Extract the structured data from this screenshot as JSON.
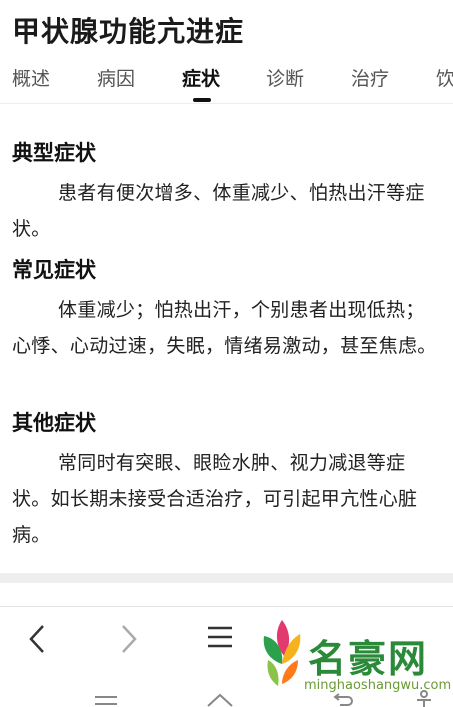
{
  "page_title": "甲状腺功能亢进症",
  "tabs": [
    {
      "label": "概述",
      "active": false
    },
    {
      "label": "病因",
      "active": false
    },
    {
      "label": "症状",
      "active": true
    },
    {
      "label": "诊断",
      "active": false
    },
    {
      "label": "治疗",
      "active": false
    },
    {
      "label": "饮",
      "active": false
    }
  ],
  "sections": [
    {
      "heading": "典型症状",
      "text": "患者有便次增多、体重减少、怕热出汗等症状。"
    },
    {
      "heading": "常见症状",
      "text": "体重减少；怕热出汗，个别患者出现低热；心悸、心动过速，失眠，情绪易激动，甚至焦虑。"
    },
    {
      "heading": "其他症状",
      "text": "常同时有突眼、眼睑水肿、视力减退等症状。如长期未接受合适治疗，可引起甲亢性心脏病。"
    }
  ],
  "bottom_nav": {
    "back_icon": "chevron-left-icon",
    "forward_icon": "chevron-right-icon",
    "menu_icon": "menu-icon",
    "home_icon": "home-icon",
    "tabs_icon": "tabs-icon"
  },
  "watermark": {
    "logo_text": "名豪网",
    "url": "minghaoshangwu.com"
  },
  "colors": {
    "watermark_green": "#2a8a3a",
    "tab_indicator": "#111111"
  }
}
